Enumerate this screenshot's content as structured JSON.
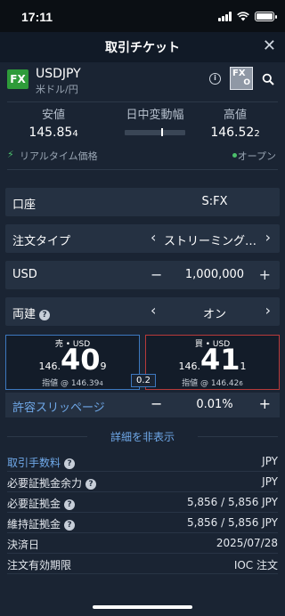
{
  "status_bar": {
    "time": "17:11"
  },
  "header": {
    "title": "取引チケット",
    "close_glyph": "✕"
  },
  "symbol": {
    "badge": "FX",
    "code": "USDJPY",
    "name": "米ドル/円",
    "fxo_top": "FX",
    "fxo_bottom": "O"
  },
  "rates": {
    "low_label": "安値",
    "low_main": "145.85",
    "low_small": "4",
    "range_label": "日中変動幅",
    "range_position": 0.62,
    "high_label": "高値",
    "high_main": "146.52",
    "high_small": "2"
  },
  "realtime": {
    "label": "リアルタイム価格",
    "status": "オープン"
  },
  "account": {
    "label": "口座",
    "value": "S:FX"
  },
  "order_type": {
    "label": "注文タイプ",
    "value": "ストリーミング…"
  },
  "quantity": {
    "label": "USD",
    "value": "1,000,000",
    "minus": "−",
    "plus": "+"
  },
  "hedge": {
    "label": "両建",
    "value": "オン"
  },
  "sell": {
    "header": "売 • USD",
    "prefix": "146.",
    "big": "40",
    "suffix": "9",
    "limit": "指値 @ 146.39",
    "limit_small": "4"
  },
  "buy": {
    "header": "買 • USD",
    "prefix": "146.",
    "big": "41",
    "suffix": "1",
    "limit": "指値 @ 146.42",
    "limit_small": "6"
  },
  "spread": "0.2",
  "slippage": {
    "label": "許容スリッページ",
    "value": "0.01%",
    "minus": "−",
    "plus": "+"
  },
  "details_toggle": "詳細を非表示",
  "details": [
    {
      "label": "取引手数料",
      "value": "JPY"
    },
    {
      "label": "必要証拠金余力",
      "value": "JPY"
    },
    {
      "label": "必要証拠金",
      "value": "5,856 / 5,856 JPY"
    },
    {
      "label": "維持証拠金",
      "value": "5,856 / 5,856 JPY"
    },
    {
      "label": "決済日",
      "value": "2025/07/28"
    },
    {
      "label": "注文有効期限",
      "value": "IOC 注文"
    }
  ],
  "colors": {
    "accent": "#6fa8e8",
    "sell_border": "#3d78bf",
    "buy_border": "#b83a3a",
    "green": "#2e9b3a"
  }
}
